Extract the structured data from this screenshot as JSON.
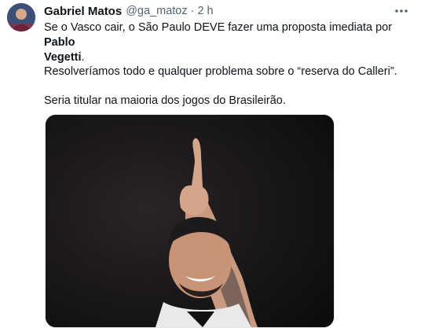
{
  "tweet": {
    "author_name": "Gabriel Matos",
    "handle": "@ga_matoz",
    "separator": "·",
    "time": "2 h",
    "more_icon": "more-horizontal-icon",
    "paragraph1_plain": "Se o Vasco cair, o São Paulo DEVE fazer uma proposta imediata por ",
    "paragraph1_bold_a": "Pablo",
    "paragraph1_bold_b": "Vegetti",
    "paragraph1_end": ".",
    "paragraph2": "Resolveríamos todo e qualquer problema sobre o “reserva do Calleri”.",
    "paragraph3": "Seria titular na maioria dos jogos do Brasileirão."
  },
  "colors": {
    "text": "#0f1419",
    "secondary": "#536471",
    "media_bg": "#121214"
  }
}
